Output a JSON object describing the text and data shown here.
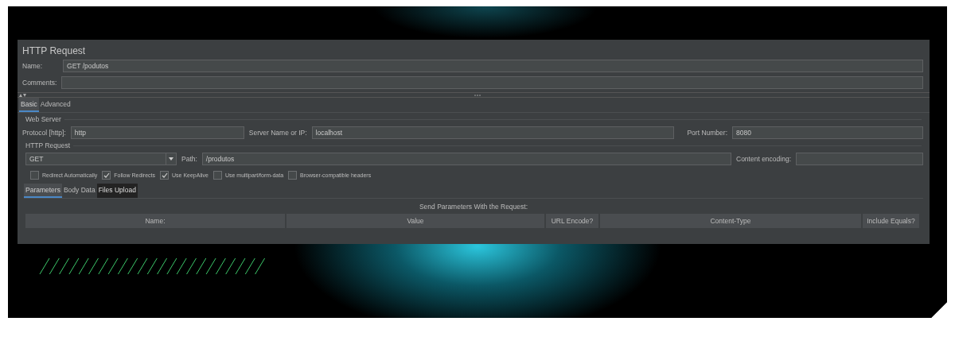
{
  "title": "HTTP Request",
  "name_field": {
    "label": "Name:",
    "value": "GET /podutos"
  },
  "comments_field": {
    "label": "Comments:"
  },
  "tabs": [
    {
      "label": "Basic",
      "selected": true
    },
    {
      "label": "Advanced",
      "selected": false
    }
  ],
  "web_server": {
    "title": "Web Server",
    "fields": [
      {
        "label": "Protocol [http]:",
        "value": "http"
      },
      {
        "label": "Server Name or IP:",
        "value": "localhost"
      },
      {
        "label": "Port Number:",
        "value": "8080"
      }
    ]
  },
  "http_request": {
    "title": "HTTP Request",
    "method": "GET",
    "path": {
      "label": "Path:",
      "value": "/produtos"
    },
    "encoding": {
      "label": "Content encoding:"
    },
    "options": [
      {
        "label": "Redirect Automatically",
        "checked": false
      },
      {
        "label": "Follow Redirects",
        "checked": true
      },
      {
        "label": "Use KeepAlive",
        "checked": true
      },
      {
        "label": "Use multipart/form-data",
        "checked": false
      },
      {
        "label": "Browser-compatible headers",
        "checked": false
      }
    ]
  },
  "sub_tabs": [
    {
      "label": "Parameters",
      "selected": true,
      "hovered": false
    },
    {
      "label": "Body Data",
      "selected": false,
      "hovered": false
    },
    {
      "label": "Files Upload",
      "selected": false,
      "hovered": true
    }
  ],
  "parameters": {
    "caption": "Send Parameters With the Request:",
    "columns": [
      "Name:",
      "Value",
      "URL Encode?",
      "Content-Type",
      "Include Equals?"
    ]
  }
}
